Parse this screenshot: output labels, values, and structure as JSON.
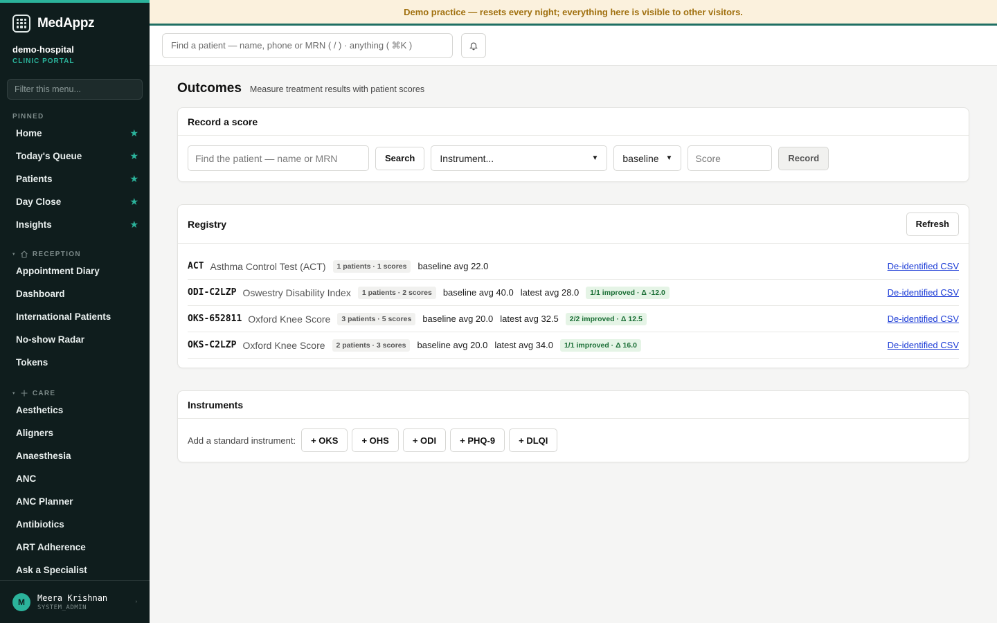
{
  "banner": {
    "text": "Demo practice — resets every night; everything here is visible to other visitors."
  },
  "brand": {
    "name": "MedAppz"
  },
  "org": {
    "name": "demo-hospital",
    "sub": "CLINIC PORTAL"
  },
  "menu_filter": {
    "placeholder": "Filter this menu..."
  },
  "sidebar": {
    "pinned_label": "PINNED",
    "pinned": [
      {
        "label": "Home"
      },
      {
        "label": "Today's Queue"
      },
      {
        "label": "Patients"
      },
      {
        "label": "Day Close"
      },
      {
        "label": "Insights"
      }
    ],
    "reception_label": "RECEPTION",
    "reception": [
      {
        "label": "Appointment Diary"
      },
      {
        "label": "Dashboard"
      },
      {
        "label": "International Patients"
      },
      {
        "label": "No-show Radar"
      },
      {
        "label": "Tokens"
      }
    ],
    "care_label": "CARE",
    "care": [
      {
        "label": "Aesthetics"
      },
      {
        "label": "Aligners"
      },
      {
        "label": "Anaesthesia"
      },
      {
        "label": "ANC"
      },
      {
        "label": "ANC Planner"
      },
      {
        "label": "Antibiotics"
      },
      {
        "label": "ART Adherence"
      },
      {
        "label": "Ask a Specialist"
      }
    ],
    "star": "★"
  },
  "user": {
    "initial": "M",
    "name": "Meera Krishnan",
    "role": "SYSTEM_ADMIN"
  },
  "topbar": {
    "search_placeholder": "Find a patient — name, phone or MRN ( / ) · anything ( ⌘K )"
  },
  "page": {
    "title": "Outcomes",
    "subtitle": "Measure treatment results with patient scores"
  },
  "record": {
    "title": "Record a score",
    "patient_placeholder": "Find the patient — name or MRN",
    "search_label": "Search",
    "instrument_value": "Instrument...",
    "timepoint_value": "baseline",
    "score_placeholder": "Score",
    "record_label": "Record"
  },
  "registry": {
    "title": "Registry",
    "refresh_label": "Refresh",
    "rows": [
      {
        "code": "ACT",
        "name": "Asthma Control Test (ACT)",
        "count": "1 patients · 1 scores",
        "baseline": "baseline avg 22.0",
        "latest": "",
        "improved": "",
        "csv": "De-identified CSV"
      },
      {
        "code": "ODI-C2LZP",
        "name": "Oswestry Disability Index",
        "count": "1 patients · 2 scores",
        "baseline": "baseline avg 40.0",
        "latest": "latest avg 28.0",
        "improved": "1/1 improved · Δ -12.0",
        "csv": "De-identified CSV"
      },
      {
        "code": "OKS-652811",
        "name": "Oxford Knee Score",
        "count": "3 patients · 5 scores",
        "baseline": "baseline avg 20.0",
        "latest": "latest avg 32.5",
        "improved": "2/2 improved · Δ 12.5",
        "csv": "De-identified CSV"
      },
      {
        "code": "OKS-C2LZP",
        "name": "Oxford Knee Score",
        "count": "2 patients · 3 scores",
        "baseline": "baseline avg 20.0",
        "latest": "latest avg 34.0",
        "improved": "1/1 improved · Δ 16.0",
        "csv": "De-identified CSV"
      }
    ]
  },
  "instruments": {
    "title": "Instruments",
    "add_label": "Add a standard instrument:",
    "buttons": [
      {
        "label": "+ OKS"
      },
      {
        "label": "+ OHS"
      },
      {
        "label": "+ ODI"
      },
      {
        "label": "+ PHQ-9"
      },
      {
        "label": "+ DLQI"
      }
    ]
  }
}
